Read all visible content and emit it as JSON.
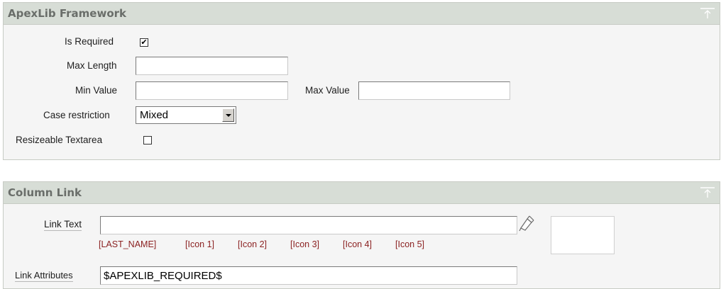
{
  "apexlib_region": {
    "title": "ApexLib Framework",
    "is_required": {
      "label": "Is Required",
      "checked": true
    },
    "max_length": {
      "label": "Max Length",
      "value": ""
    },
    "min_value": {
      "label": "Min Value",
      "value": ""
    },
    "max_value": {
      "label": "Max Value",
      "value": ""
    },
    "case_restriction": {
      "label": "Case restriction",
      "selected": "Mixed"
    },
    "resizeable_textarea": {
      "label": "Resizeable Textarea",
      "checked": false
    }
  },
  "column_link_region": {
    "title": "Column Link",
    "link_text": {
      "label": "Link Text",
      "value": ""
    },
    "substitutions": [
      "[LAST_NAME]",
      "[Icon 1]",
      "[Icon 2]",
      "[Icon 3]",
      "[Icon 4]",
      "[Icon 5]"
    ],
    "link_attributes": {
      "label": "Link Attributes",
      "value": "$APEXLIB_REQUIRED$"
    }
  },
  "icons": {
    "top": "arrow-up-to-top-icon",
    "picker": "pencil-icon"
  }
}
